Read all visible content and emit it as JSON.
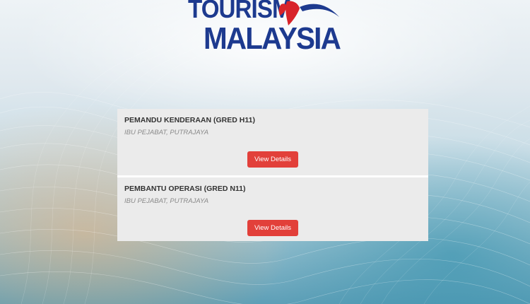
{
  "logo": {
    "line1": "TOURISM",
    "line2": "MALAYSIA"
  },
  "jobs": [
    {
      "title": "PEMANDU KENDERAAN (GRED H11)",
      "location": "IBU PEJABAT, PUTRAJAYA",
      "button_label": "View Details"
    },
    {
      "title": "PEMBANTU OPERASI (GRED N11)",
      "location": "IBU PEJABAT, PUTRAJAYA",
      "button_label": "View Details"
    }
  ],
  "colors": {
    "logo_blue": "#1d3a8f",
    "logo_red": "#d8232a",
    "button_red": "#e2403a",
    "card_bg": "#ebebeb"
  }
}
